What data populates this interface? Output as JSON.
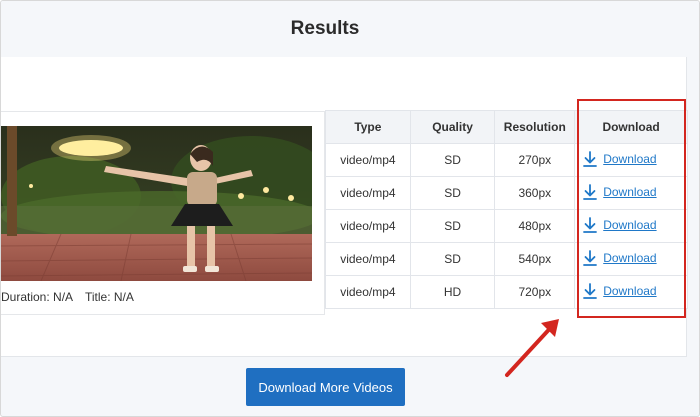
{
  "header": {
    "title": "Results"
  },
  "video": {
    "duration_text": "Duration: N/A",
    "title_text": "Title: N/A"
  },
  "table": {
    "headers": [
      "Type",
      "Quality",
      "Resolution",
      "Download"
    ],
    "rows": [
      {
        "type": "video/mp4",
        "quality": "SD",
        "resolution": "270px",
        "download_label": "Download"
      },
      {
        "type": "video/mp4",
        "quality": "SD",
        "resolution": "360px",
        "download_label": "Download"
      },
      {
        "type": "video/mp4",
        "quality": "SD",
        "resolution": "480px",
        "download_label": "Download"
      },
      {
        "type": "video/mp4",
        "quality": "SD",
        "resolution": "540px",
        "download_label": "Download"
      },
      {
        "type": "video/mp4",
        "quality": "HD",
        "resolution": "720px",
        "download_label": "Download"
      }
    ]
  },
  "footer": {
    "more_button_label": "Download More Videos"
  },
  "icons": {
    "download": "download-arrow-icon"
  },
  "colors": {
    "accent": "#1f6fc1",
    "link": "#1f78c8",
    "annotation": "#d3261f"
  }
}
